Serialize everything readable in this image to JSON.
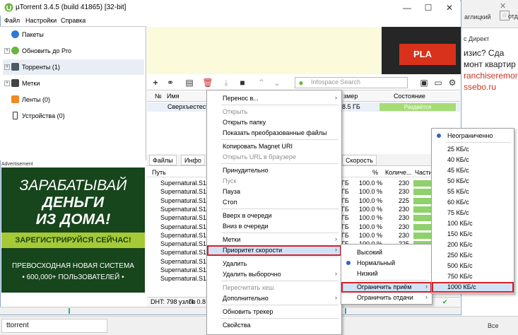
{
  "app": {
    "title": "µTorrent 3.4.5  (build 41865) [32-bit]",
    "colors": {
      "accent": "#2f64c8",
      "highlight_border": "#d4202a",
      "logo_green": "#6cb43f"
    }
  },
  "menubar": [
    "Файл",
    "Настройки",
    "Справка"
  ],
  "sidebar": {
    "items": [
      {
        "label": "Пакеты",
        "icon": "packages-icon"
      },
      {
        "label": "Обновить до Pro",
        "icon": "utorrent-icon"
      },
      {
        "label": "Торренты (1)",
        "icon": "torrents-icon"
      },
      {
        "label": "Метки",
        "icon": "labels-icon"
      },
      {
        "label": "Ленты (0)",
        "icon": "rss-icon"
      },
      {
        "label": "Устройства (0)",
        "icon": "devices-icon"
      }
    ]
  },
  "ad": {
    "label": "Advertisement",
    "line1": "ЗАРАБАТЫВАЙ",
    "line2": "ДЕНЬГИ",
    "line3": "ИЗ ДОМА!",
    "cta": "ЗАРЕГИСТРИРУЙСЯ СЕЙЧАС!",
    "sub1": "ПРЕВОСХОДНАЯ НОВАЯ СИСТЕМА",
    "sub2": "• 600,000+ ПОЛЬЗОВАТЕЛЕЙ •"
  },
  "top_ad": {
    "button": "PLA"
  },
  "search": {
    "placeholder": "Infospace Search"
  },
  "list": {
    "columns": [
      "№",
      "Имя",
      "змер",
      "Состояние"
    ],
    "rows": [
      {
        "name": "Сверхъестеств",
        "size": "8.5 ГБ",
        "status": "Раздаётся"
      }
    ]
  },
  "tabs": [
    "Файлы",
    "Инфо",
    "Скорость"
  ],
  "files": {
    "columns": [
      "Путь",
      "%",
      "Количе...",
      "Части"
    ],
    "rows": [
      {
        "name": "Supernatural.S11E",
        "size": "ГБ",
        "pct": "100.0 %",
        "count": "230"
      },
      {
        "name": "Supernatural.S11E",
        "size": "ГБ",
        "pct": "100.0 %",
        "count": "230"
      },
      {
        "name": "Supernatural.S11E",
        "size": "ГБ",
        "pct": "100.0 %",
        "count": "225"
      },
      {
        "name": "Supernatural.S11E",
        "size": "ГБ",
        "pct": "100.0 %",
        "count": "230"
      },
      {
        "name": "Supernatural.S11E",
        "size": "ГБ",
        "pct": "100.0 %",
        "count": "230"
      },
      {
        "name": "Supernatural.S11E",
        "size": "ГБ",
        "pct": "100.0 %",
        "count": "230"
      },
      {
        "name": "Supernatural.S11E",
        "size": "ГБ",
        "pct": "100.0 %",
        "count": "230"
      },
      {
        "name": "Supernatural.S11E",
        "size": "ГБ",
        "pct": "100.0 %",
        "count": "225"
      },
      {
        "name": "Supernatural.S11E",
        "size": "",
        "pct": "",
        "count": ""
      },
      {
        "name": "Supernatural.S11E",
        "size": "",
        "pct": "",
        "count": ""
      },
      {
        "name": "Supernatural.S11E",
        "size": "",
        "pct": "",
        "count": ""
      },
      {
        "name": "Supernatural.S11E",
        "size": "",
        "pct": "",
        "count": ""
      }
    ]
  },
  "statusbar": {
    "dht": "DHT: 798 узлов",
    "p": "П: 0.8"
  },
  "context_menu": {
    "items": [
      {
        "label": "Перенос в...",
        "arrow": "›"
      },
      {
        "label": "Открыть",
        "disabled": true
      },
      {
        "label": "Открыть папку"
      },
      {
        "label": "Показать преобразованные файлы"
      },
      {
        "label": "Копировать Magnet URI"
      },
      {
        "label": "Открыть URL в браузере",
        "disabled": true
      },
      {
        "label": "Принудительно"
      },
      {
        "label": "Пуск",
        "disabled": true
      },
      {
        "label": "Пауза"
      },
      {
        "label": "Стоп"
      },
      {
        "label": "Вверх в очереди"
      },
      {
        "label": "Вниз в очереди"
      },
      {
        "label": "Метки",
        "arrow": "›"
      },
      {
        "label": "Приоритет скорости",
        "arrow": "›",
        "highlight": true
      },
      {
        "label": "Удалить"
      },
      {
        "label": "Удалить выборочно",
        "arrow": "›"
      },
      {
        "label": "Пересчитать хеш",
        "disabled": true
      },
      {
        "label": "Дополнительно",
        "arrow": "›"
      },
      {
        "label": "Обновить трекер"
      },
      {
        "label": "Свойства"
      }
    ]
  },
  "priority_menu": {
    "items": [
      {
        "label": "Высокий"
      },
      {
        "label": "Нормальный",
        "checked": true
      },
      {
        "label": "Низкий"
      },
      {
        "label": "Ограничить приём",
        "arrow": "›",
        "highlight": true
      },
      {
        "label": "Ограничить отдачи",
        "arrow": "›"
      }
    ]
  },
  "limit_menu": {
    "items": [
      {
        "label": "Неограниченно",
        "checked": true
      },
      {
        "label": "25 КБ/с"
      },
      {
        "label": "40 КБ/с"
      },
      {
        "label": "45 КБ/с"
      },
      {
        "label": "50 КБ/с"
      },
      {
        "label": "55 КБ/с"
      },
      {
        "label": "60 КБ/с"
      },
      {
        "label": "75 КБ/с"
      },
      {
        "label": "100 КБ/с"
      },
      {
        "label": "150 КБ/с"
      },
      {
        "label": "200 КБ/с"
      },
      {
        "label": "250 КБ/с"
      },
      {
        "label": "500 КБ/с"
      },
      {
        "label": "750 КБ/с"
      },
      {
        "label": "1000 КБ/с",
        "highlight": true
      }
    ]
  },
  "background": {
    "lang": "аглицкий",
    "bookmarks": "отд",
    "ad_line1": "с Директ",
    "ad_line2": "изис? Сда",
    "ad_line3": "монт квартир",
    "ad_line4": "ranchiseremont",
    "ad_line5": "ssebo.ru",
    "bottom_tab": "ttorrent",
    "bottom_right": "Все"
  }
}
